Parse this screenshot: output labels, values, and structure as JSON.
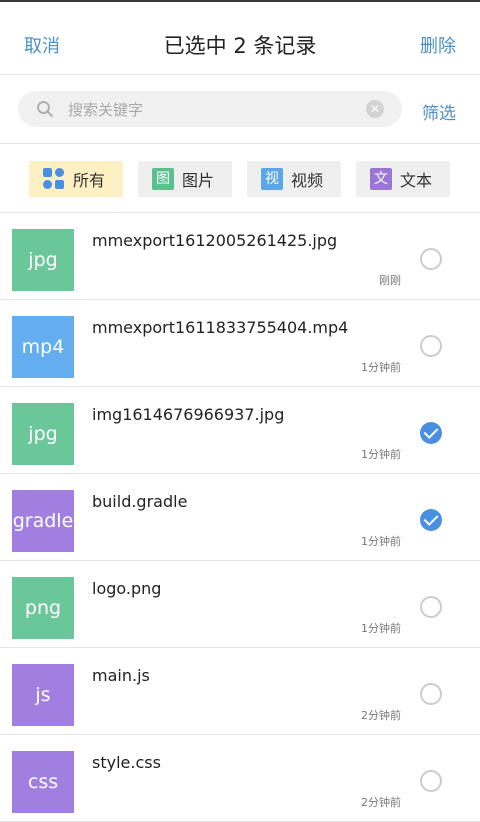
{
  "header": {
    "cancel_label": "取消",
    "title": "已选中 2 条记录",
    "delete_label": "删除"
  },
  "search": {
    "placeholder": "搜索关键字",
    "value": "",
    "icon": "search-icon",
    "clear_icon": "clear-icon",
    "filter_label": "筛选"
  },
  "categories": [
    {
      "label": "所有",
      "icon": "grid-icon",
      "active": true
    },
    {
      "label": "图片",
      "icon_text": "图",
      "icon_color": "#5bbf8e",
      "active": false
    },
    {
      "label": "视频",
      "icon_text": "视",
      "icon_color": "#5aa6e6",
      "active": false
    },
    {
      "label": "文本",
      "icon_text": "文",
      "icon_color": "#9a77d6",
      "active": false
    }
  ],
  "colors": {
    "accent": "#4a90c8",
    "check": "#4a90e2",
    "thumb_green": "#6ac79a",
    "thumb_blue": "#64aef0",
    "thumb_purple": "#a17fe0"
  },
  "files": [
    {
      "ext": "jpg",
      "color": "#6ac79a",
      "name": "mmexport1612005261425.jpg",
      "time": "刚刚",
      "checked": false
    },
    {
      "ext": "mp4",
      "color": "#64aef0",
      "name": "mmexport1611833755404.mp4",
      "time": "1分钟前",
      "checked": false
    },
    {
      "ext": "jpg",
      "color": "#6ac79a",
      "name": "img1614676966937.jpg",
      "time": "1分钟前",
      "checked": true
    },
    {
      "ext": "gradle",
      "color": "#a17fe0",
      "name": "build.gradle",
      "time": "1分钟前",
      "checked": true
    },
    {
      "ext": "png",
      "color": "#6ac79a",
      "name": "logo.png",
      "time": "1分钟前",
      "checked": false
    },
    {
      "ext": "js",
      "color": "#a17fe0",
      "name": "main.js",
      "time": "2分钟前",
      "checked": false
    },
    {
      "ext": "css",
      "color": "#a17fe0",
      "name": "style.css",
      "time": "2分钟前",
      "checked": false
    }
  ]
}
